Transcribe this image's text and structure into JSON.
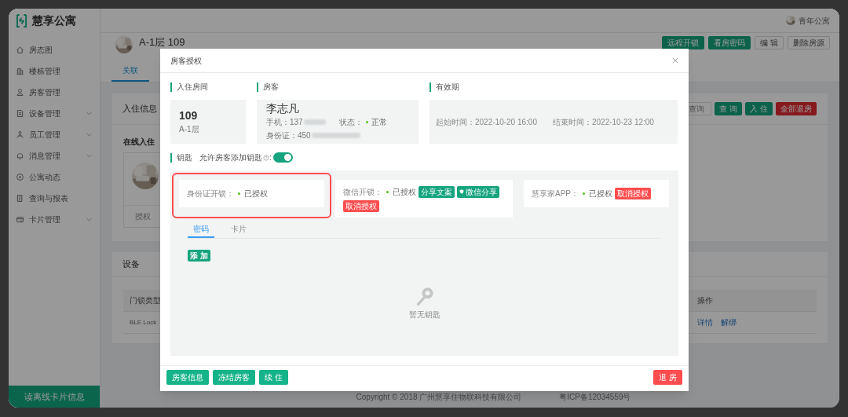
{
  "app": {
    "logo": "慧享公寓",
    "user": "青年公寓"
  },
  "sidebar": {
    "items": [
      {
        "label": "房态图",
        "expandable": false
      },
      {
        "label": "楼栋管理",
        "expandable": false
      },
      {
        "label": "房客管理",
        "expandable": false
      },
      {
        "label": "设备管理",
        "expandable": true
      },
      {
        "label": "员工管理",
        "expandable": true
      },
      {
        "label": "消息管理",
        "expandable": true
      },
      {
        "label": "公寓动态",
        "expandable": false
      },
      {
        "label": "查询与报表",
        "expandable": false
      },
      {
        "label": "卡片管理",
        "expandable": true
      }
    ],
    "footer_button": "读离线卡片信息"
  },
  "room": {
    "title": "A-1层 109",
    "actions": [
      {
        "label": "远程开锁",
        "kind": "primary"
      },
      {
        "label": "看房密码",
        "kind": "primary"
      },
      {
        "label": "编 辑",
        "kind": "default"
      },
      {
        "label": "删除房源",
        "kind": "default"
      }
    ],
    "tabs": [
      {
        "label": "关联",
        "selected": true
      }
    ]
  },
  "checkin_card": {
    "title": "入住信息",
    "search": {
      "placeholder": "查询"
    },
    "actions": [
      {
        "label": "查 询",
        "kind": "primary"
      },
      {
        "label": "入 住",
        "kind": "primary"
      },
      {
        "label": "全部退房",
        "kind": "danger"
      }
    ],
    "subtitle": "在线入住",
    "tenant_action": "授权"
  },
  "device_card": {
    "title": "设备",
    "columns": [
      "门锁类型",
      "操作"
    ],
    "rows": [
      {
        "lock_type": "BLE Lock",
        "links": [
          "详情",
          "解绑"
        ]
      }
    ]
  },
  "footer": {
    "copyright": "Copyright © 2018 广州慧享住物联科技有限公司",
    "icp": "粤ICP备12034559号"
  },
  "dialog": {
    "title": "房客授权",
    "room": {
      "heading": "入住房间",
      "number": "109",
      "floor": "A-1层"
    },
    "tenant": {
      "heading": "房客",
      "name": "李志凡",
      "phone_label": "手机：",
      "phone": "137",
      "status_label": "状态：",
      "status": "正常",
      "id_label": "身份证：",
      "id": "450",
      "redacted": true
    },
    "validity": {
      "heading": "有效期",
      "start_label": "起始时间：",
      "start": "2022-10-20 16:00",
      "end_label": "结束时间：",
      "end": "2022-10-23 12:00"
    },
    "keys": {
      "heading": "钥匙",
      "allow_label": "允许房客添加钥匙",
      "allow_colon": ":",
      "allow_on": true,
      "methods": [
        {
          "label": "身份证开锁：",
          "status": "已授权",
          "highlighted": true
        },
        {
          "label": "微信开锁：",
          "status": "已授权",
          "highlighted": false,
          "actions": [
            {
              "label": "分享文案",
              "kind": "share"
            },
            {
              "label": "微信分享",
              "kind": "wechat"
            },
            {
              "label": "取消授权",
              "kind": "revoke"
            }
          ]
        },
        {
          "label": "慧享家APP：",
          "status": "已授权",
          "highlighted": false,
          "actions": [
            {
              "label": "取消授权",
              "kind": "revoke"
            }
          ]
        }
      ],
      "tabs": [
        {
          "label": "密码",
          "selected": true
        },
        {
          "label": "卡片",
          "selected": false
        }
      ],
      "add_button": "添 加",
      "empty_text": "暂无钥匙"
    },
    "footer_buttons": [
      {
        "label": "房客信息",
        "kind": "primary"
      },
      {
        "label": "冻结房客",
        "kind": "primary"
      },
      {
        "label": "续 住",
        "kind": "primary"
      },
      {
        "label": "退 房",
        "kind": "danger"
      }
    ]
  }
}
